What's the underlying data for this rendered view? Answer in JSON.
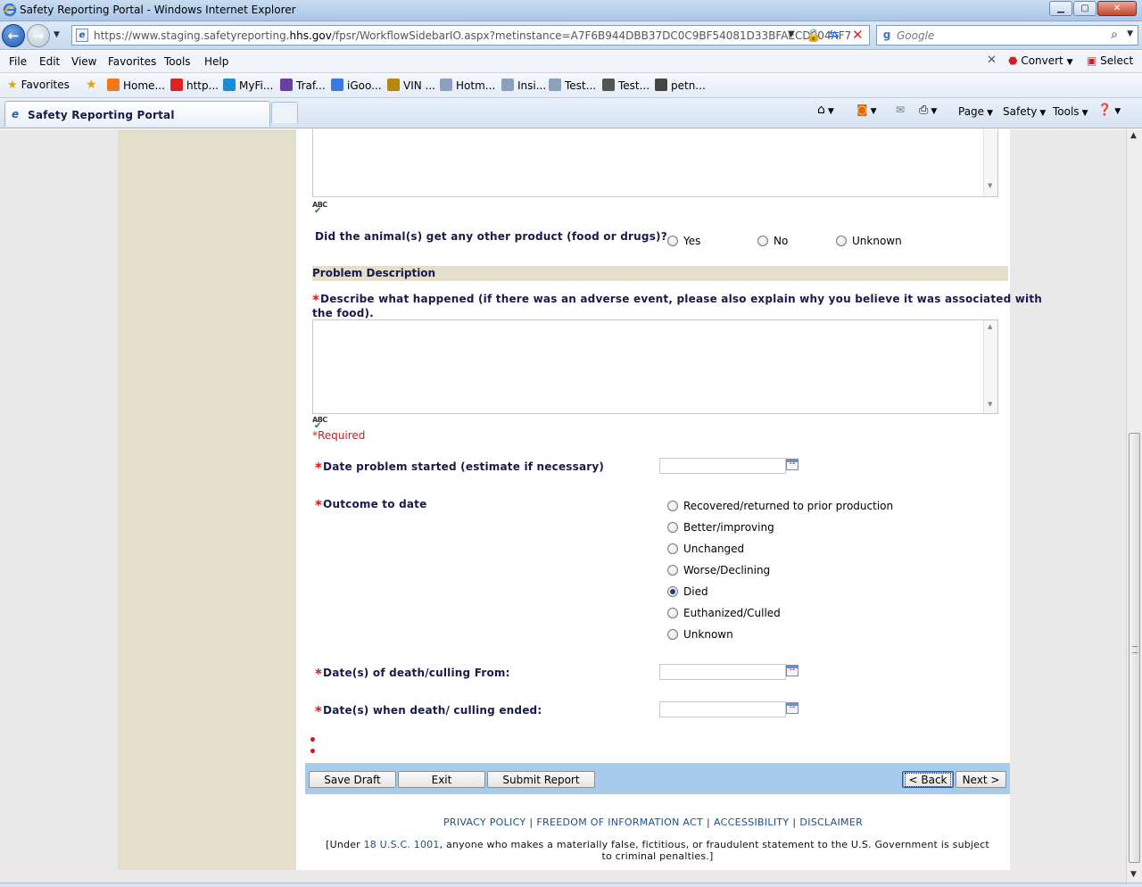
{
  "browser": {
    "title": "Safety Reporting Portal - Windows Internet Explorer",
    "url_prefix": "https://www.staging.safetyreporting.",
    "url_domain": "hhs.gov",
    "url_suffix": "/fpsr/WorkflowSidebarIO.aspx?metinstance=A7F6B944DBB37DC0C9BF54081D33BFAECD004AF7",
    "search_placeholder": "Google",
    "menus": [
      "File",
      "Edit",
      "View",
      "Favorites",
      "Tools",
      "Help"
    ],
    "toolbar_convert": "Convert",
    "toolbar_select": "Select",
    "favorites_label": "Favorites",
    "favorites": [
      "Home...",
      "http...",
      "MyFi...",
      "Traf...",
      "iGoo...",
      "VIN ...",
      "Hotm...",
      "Insi...",
      "Test...",
      "Test...",
      "petn..."
    ],
    "tab_title": "Safety Reporting Portal",
    "command_bar": {
      "page": "Page",
      "safety": "Safety",
      "tools": "Tools"
    }
  },
  "form": {
    "other_product": {
      "question": "Did the animal(s) get any other product (food or drugs)?",
      "options": [
        "Yes",
        "No",
        "Unknown"
      ]
    },
    "problem_section": "Problem Description",
    "describe_label_line1": "Describe what happened (if there was an adverse event, please also explain why you believe it was associated with",
    "describe_label_line2": "the food).",
    "spell_label": "ABC",
    "required_note": "*Required",
    "date_started_label": "Date problem started (estimate if necessary)",
    "outcome_label": "Outcome to date",
    "outcome_options": [
      "Recovered/returned to prior production",
      "Better/improving",
      "Unchanged",
      "Worse/Declining",
      "Died",
      "Euthanized/Culled",
      "Unknown"
    ],
    "outcome_selected": "Died",
    "death_from_label": "Date(s) of death/culling From:",
    "death_ended_label": "Date(s) when death/ culling ended:",
    "calendar_label": "12"
  },
  "buttons": {
    "save_draft": "Save Draft",
    "exit": "Exit",
    "submit": "Submit Report",
    "back": "< Back",
    "next": "Next >"
  },
  "footer": {
    "links": [
      "PRIVACY POLICY",
      "FREEDOM OF INFORMATION ACT",
      "ACCESSIBILITY",
      "DISCLAIMER"
    ],
    "note_pre": "[Under ",
    "note_link": "18 U.S.C. 1001",
    "note_post": ", anyone who makes a materially false, fictitious, or fraudulent statement to the U.S. Government is subject to criminal penalties.]"
  }
}
